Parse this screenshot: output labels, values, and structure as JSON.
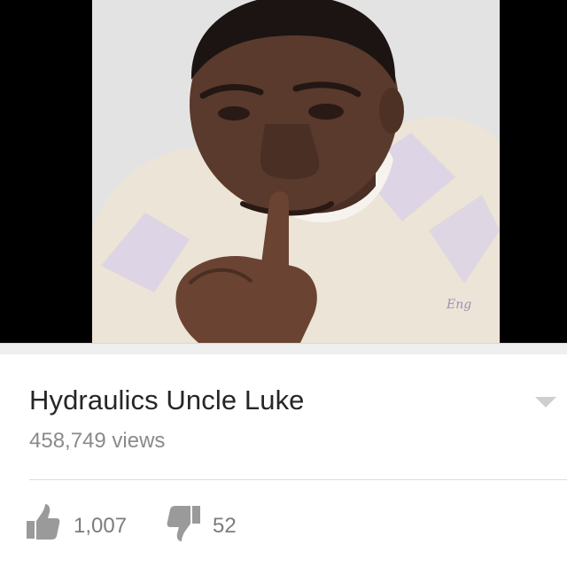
{
  "player": {
    "thumbnail_alt": "",
    "logo_text": "Eng"
  },
  "video": {
    "title": "Hydraulics Uncle Luke",
    "views": "458,749 views"
  },
  "icons": {
    "expand": "chevron-down-icon",
    "like": "thumbs-up-icon",
    "dislike": "thumbs-down-icon"
  },
  "actions": {
    "like_count": "1,007",
    "dislike_count": "52"
  },
  "colors": {
    "title": "#262626",
    "secondary_text": "#8a8a8a",
    "icon_gray": "#9a9a9a",
    "player_background": "#000000",
    "divider": "#efefef"
  }
}
